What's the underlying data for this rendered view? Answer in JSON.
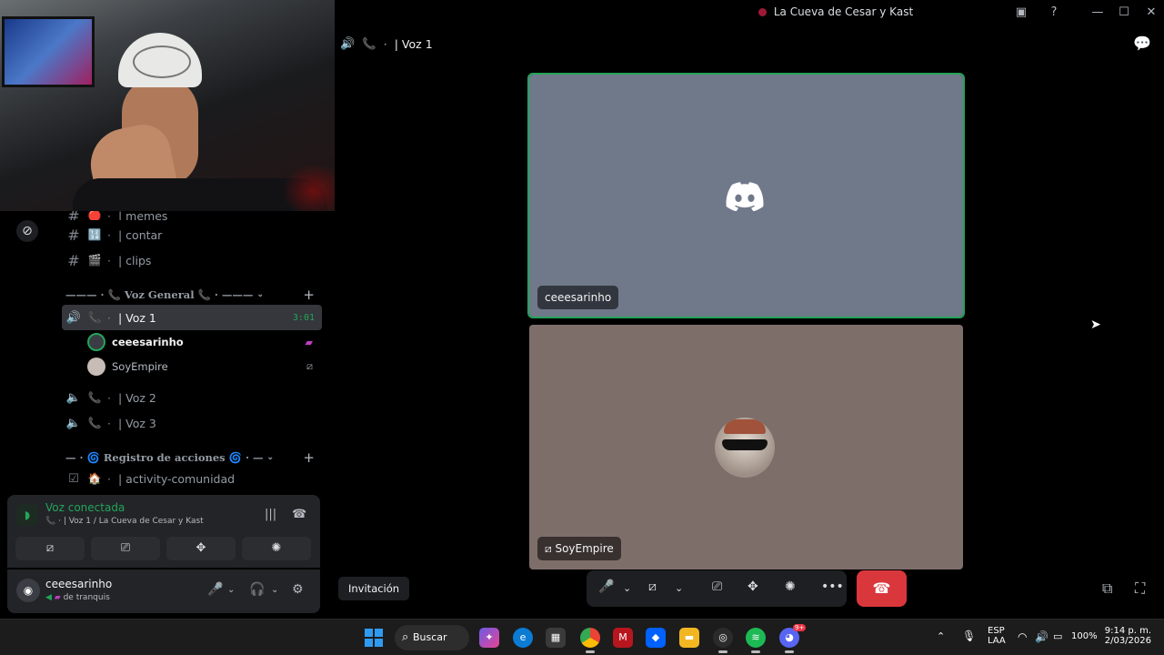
{
  "window": {
    "title": "La Cueva de Cesar y Kast"
  },
  "channels": {
    "top_partial": "| memes",
    "contar": "| contar",
    "clips": "| clips",
    "category_voice": "——— · 📞 Voz General 📞 · ———",
    "voz1": "| Voz 1",
    "voz1_timer": "3:01",
    "voz2": "| Voz 2",
    "voz3": "| Voz 3",
    "category_log": "— · 🌀 Registro de acciones 🌀 · —",
    "activity": "| activity-comunidad"
  },
  "voice_members": [
    {
      "name": "ceeesarinho"
    },
    {
      "name": "SoyEmpire"
    }
  ],
  "voice_panel": {
    "status": "Voz conectada",
    "location": "| Voz 1 / La Cueva de Cesar y Kast"
  },
  "user_panel": {
    "username": "ceeesarinho",
    "status": "de tranquis"
  },
  "main": {
    "channel_title": "| Voz 1",
    "tile1_name": "ceeesarinho",
    "tile2_name": "SoyEmpire",
    "invite_label": "Invitación"
  },
  "taskbar": {
    "search": "Buscar",
    "lang_line1": "ESP",
    "lang_line2": "LAA",
    "battery": "100%",
    "time": "9:14 p. m.",
    "date": "2/03/2026",
    "discord_badge": "9+"
  },
  "colors": {
    "accent_green": "#23a55a",
    "hangup_red": "#da373c",
    "phone_pink": "#e6457a"
  }
}
